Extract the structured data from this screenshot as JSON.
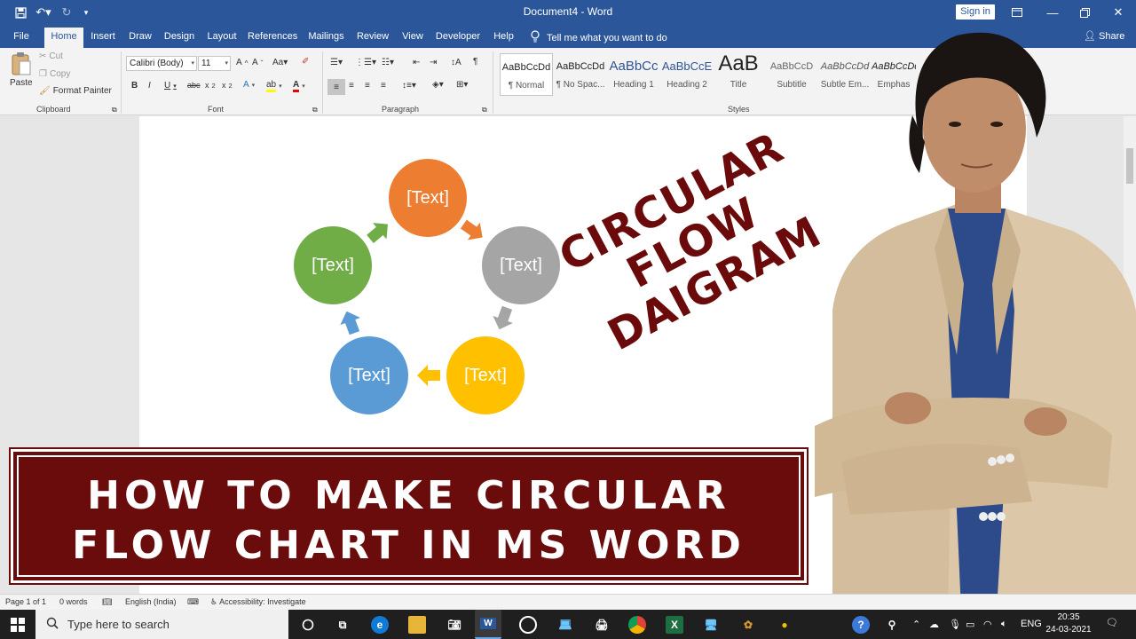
{
  "window": {
    "doc_title": "Document4  -  Word",
    "sign_in": "Sign in"
  },
  "tabs": [
    {
      "label": "File"
    },
    {
      "label": "Home"
    },
    {
      "label": "Insert"
    },
    {
      "label": "Draw"
    },
    {
      "label": "Design"
    },
    {
      "label": "Layout"
    },
    {
      "label": "References"
    },
    {
      "label": "Mailings"
    },
    {
      "label": "Review"
    },
    {
      "label": "View"
    },
    {
      "label": "Developer"
    },
    {
      "label": "Help"
    }
  ],
  "tell_me": "Tell me what you want to do",
  "share": "Share",
  "clipboard": {
    "paste": "Paste",
    "cut": "Cut",
    "copy": "Copy",
    "format_painter": "Format Painter",
    "label": "Clipboard"
  },
  "font": {
    "family": "Calibri (Body)",
    "size": "11",
    "label": "Font"
  },
  "paragraph": {
    "label": "Paragraph"
  },
  "styles": {
    "label": "Styles",
    "items": [
      {
        "preview": "AaBbCcDd",
        "name": "¶ Normal"
      },
      {
        "preview": "AaBbCcDd",
        "name": "¶ No Spac..."
      },
      {
        "preview": "AaBbCc",
        "name": "Heading 1"
      },
      {
        "preview": "AaBbCcE",
        "name": "Heading 2"
      },
      {
        "preview": "AaB",
        "name": "Title"
      },
      {
        "preview": "AaBbCcD",
        "name": "Subtitle"
      },
      {
        "preview": "AaBbCcDd",
        "name": "Subtle Em..."
      },
      {
        "preview": "AaBbCcDd",
        "name": "Emphas"
      }
    ]
  },
  "diagram": {
    "nodes": [
      {
        "label": "[Text]",
        "color": "#ed7d31"
      },
      {
        "label": "[Text]",
        "color": "#a5a5a5"
      },
      {
        "label": "[Text]",
        "color": "#ffc000"
      },
      {
        "label": "[Text]",
        "color": "#5b9bd5"
      },
      {
        "label": "[Text]",
        "color": "#70ad47"
      }
    ]
  },
  "overlay": {
    "line1": "CIRCULAR",
    "line2": "FLOW",
    "line3": "DAIGRAM",
    "color": "#6b0a0a"
  },
  "banner": {
    "line1": "HOW TO MAKE CIRCULAR",
    "line2": "FLOW CHART IN MS WORD",
    "background": "#6a0c0c"
  },
  "statusbar": {
    "page": "Page 1 of 1",
    "words": "0 words",
    "language": "English (India)",
    "accessibility": "Accessibility: Investigate"
  },
  "taskbar": {
    "search_placeholder": "Type here to search",
    "lang": "ENG",
    "time": "20:35",
    "date": "24-03-2021"
  }
}
